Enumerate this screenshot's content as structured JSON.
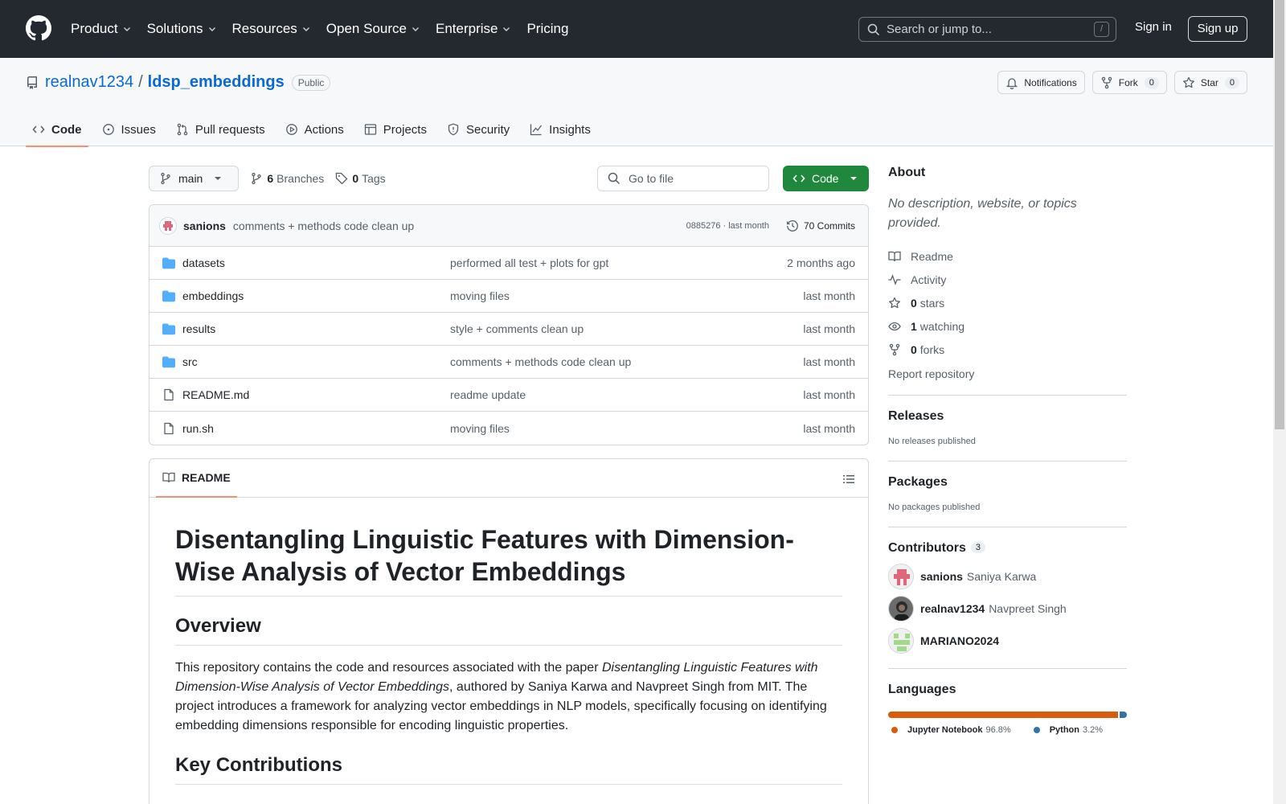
{
  "topbar": {
    "nav": [
      {
        "label": "Product",
        "caret": true
      },
      {
        "label": "Solutions",
        "caret": true
      },
      {
        "label": "Resources",
        "caret": true
      },
      {
        "label": "Open Source",
        "caret": true
      },
      {
        "label": "Enterprise",
        "caret": true
      },
      {
        "label": "Pricing",
        "caret": false
      }
    ],
    "search_placeholder": "Search or jump to...",
    "search_key": "/",
    "sign_in": "Sign in",
    "sign_up": "Sign up"
  },
  "repo": {
    "owner": "realnav1234",
    "separator": "/",
    "name": "ldsp_embeddings",
    "visibility": "Public",
    "notifications_label": "Notifications",
    "fork_label": "Fork",
    "fork_count": "0",
    "star_label": "Star",
    "star_count": "0",
    "tabs": [
      "Code",
      "Issues",
      "Pull requests",
      "Actions",
      "Projects",
      "Security",
      "Insights"
    ]
  },
  "toolbar": {
    "branch": "main",
    "branches_count": "6",
    "branches_label": "Branches",
    "tags_count": "0",
    "tags_label": "Tags",
    "goto_file": "Go to file",
    "code_button": "Code"
  },
  "latest_commit": {
    "author": "sanions",
    "message": "comments + methods code clean up",
    "sha_and_time": "0885276 · last month",
    "commits_label": "70 Commits"
  },
  "files": [
    {
      "type": "dir",
      "name": "datasets",
      "message": "performed all test + plots for gpt",
      "date": "2 months ago"
    },
    {
      "type": "dir",
      "name": "embeddings",
      "message": "moving files",
      "date": "last month"
    },
    {
      "type": "dir",
      "name": "results",
      "message": "style + comments clean up",
      "date": "last month"
    },
    {
      "type": "dir",
      "name": "src",
      "message": "comments + methods code clean up",
      "date": "last month"
    },
    {
      "type": "file",
      "name": "README.md",
      "message": "readme update",
      "date": "last month"
    },
    {
      "type": "file",
      "name": "run.sh",
      "message": "moving files",
      "date": "last month"
    }
  ],
  "readme": {
    "tab_label": "README",
    "title": "Disentangling Linguistic Features with Dimension-Wise Analysis of Vector Embeddings",
    "overview_heading": "Overview",
    "overview_p1": "This repository contains the code and resources associated with the paper ",
    "overview_paper": "Disentangling Linguistic Features with Dimension-Wise Analysis of Vector Embeddings",
    "overview_p2": ", authored by Saniya Karwa and Navpreet Singh from MIT. The project introduces a framework for analyzing vector embeddings in NLP models, specifically focusing on identifying embedding dimensions responsible for encoding linguistic properties.",
    "key_heading": "Key Contributions"
  },
  "about": {
    "heading": "About",
    "description": "No description, website, or topics provided.",
    "readme": "Readme",
    "activity": "Activity",
    "stars_count": "0",
    "stars_label": "stars",
    "watching_count": "1",
    "watching_label": "watching",
    "forks_count": "0",
    "forks_label": "forks",
    "report": "Report repository"
  },
  "releases": {
    "heading": "Releases",
    "text": "No releases published"
  },
  "packages": {
    "heading": "Packages",
    "text": "No packages published"
  },
  "contributors": {
    "heading": "Contributors",
    "count": "3",
    "list": [
      {
        "login": "sanions",
        "name": "Saniya Karwa"
      },
      {
        "login": "realnav1234",
        "name": "Navpreet Singh"
      },
      {
        "login": "MARIANO2024",
        "name": ""
      }
    ]
  },
  "languages": {
    "heading": "Languages",
    "list": [
      {
        "name": "Jupyter Notebook",
        "percent": "96.8%",
        "value": 96.8,
        "color": "#DA5B0B"
      },
      {
        "name": "Python",
        "percent": "3.2%",
        "value": 3.2,
        "color": "#3572A5"
      }
    ]
  }
}
